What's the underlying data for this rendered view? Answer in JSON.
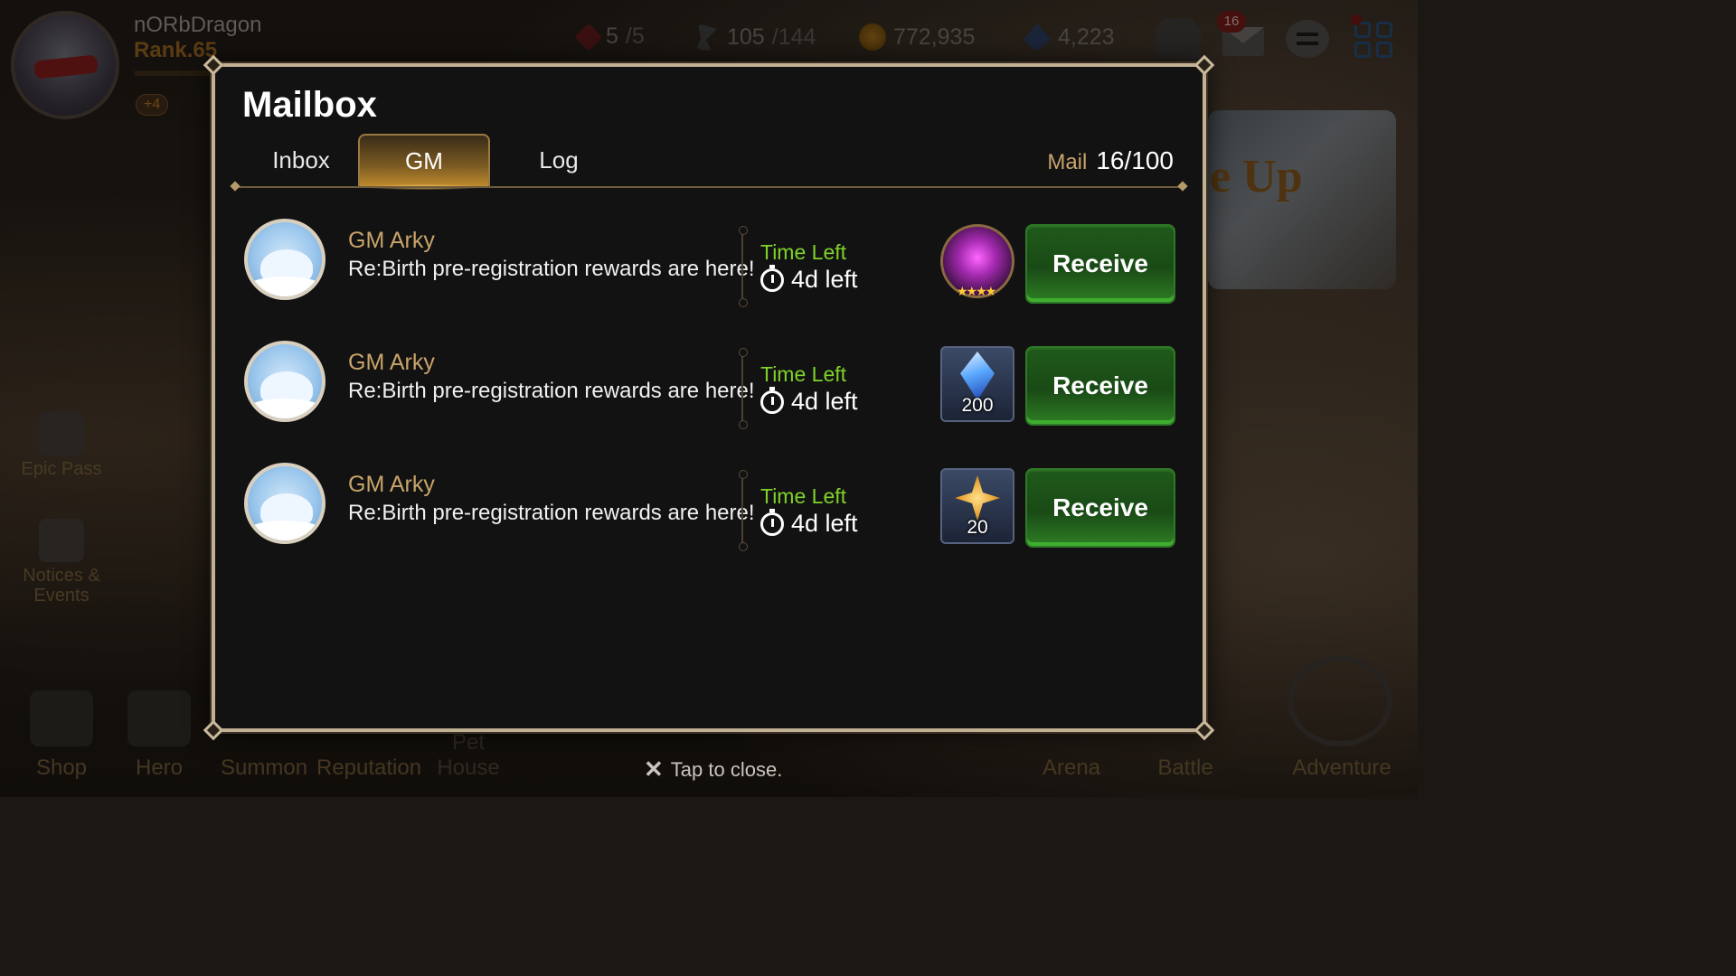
{
  "player": {
    "name": "nORbDragon",
    "rank": "Rank.65",
    "badge": "+4"
  },
  "resources": {
    "stamina": {
      "current": "5",
      "max": "/5"
    },
    "flags": {
      "current": "105",
      "max": "/144"
    },
    "gold": "772,935",
    "crystals": "4,223"
  },
  "top_icons": {
    "mail_badge": "16"
  },
  "side_menu": [
    {
      "label": "Epic Pass"
    },
    {
      "label": "Notices & Events"
    }
  ],
  "banner": {
    "text": "e Up"
  },
  "bottom_nav": [
    {
      "label": "Shop"
    },
    {
      "label": "Hero"
    },
    {
      "label": "Summon"
    },
    {
      "label": "Reputation"
    },
    {
      "label": "Pet House"
    },
    {
      "label": "Arena"
    },
    {
      "label": "Battle"
    },
    {
      "label": "Adventure"
    }
  ],
  "close_hint": {
    "icon": "close-icon",
    "label": "Tap to close."
  },
  "mailbox": {
    "title": "Mailbox",
    "tabs": [
      {
        "label": "Inbox",
        "active": false
      },
      {
        "label": "GM",
        "active": true
      },
      {
        "label": "Log",
        "active": false
      }
    ],
    "mail_label": "Mail",
    "mail_count": "16/100",
    "messages": [
      {
        "sender": "GM Arky",
        "subject": "Re:Birth pre-registration rewards are here!",
        "time_label": "Time Left",
        "time_left": "4d left",
        "reward": {
          "type": "orb",
          "icon": "summon-orb-icon",
          "stars": "★★★★",
          "quantity": ""
        },
        "button": "Receive"
      },
      {
        "sender": "GM Arky",
        "subject": "Re:Birth pre-registration rewards are here!",
        "time_label": "Time Left",
        "time_left": "4d left",
        "reward": {
          "type": "gem",
          "icon": "crystal-icon",
          "stars": "",
          "quantity": "200"
        },
        "button": "Receive"
      },
      {
        "sender": "GM Arky",
        "subject": "Re:Birth pre-registration rewards are here!",
        "time_label": "Time Left",
        "time_left": "4d left",
        "reward": {
          "type": "star",
          "icon": "star-charm-icon",
          "stars": "",
          "quantity": "20"
        },
        "button": "Receive"
      }
    ]
  },
  "colors": {
    "accent_gold": "#c9a46a",
    "timer_green": "#7fd22a",
    "receive_green": "#1f5a1a",
    "modal_border": "#c2b093"
  }
}
